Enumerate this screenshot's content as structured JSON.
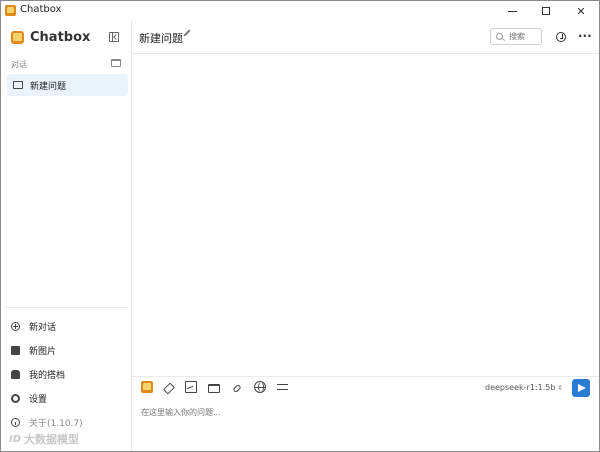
{
  "window": {
    "title": "Chatbox",
    "controls": {
      "minimize": "minimize",
      "maximize": "maximize",
      "close": "✕"
    }
  },
  "sidebar": {
    "brand": "Chatbox",
    "section_label": "对话",
    "conversations": [
      {
        "label": "新建问题",
        "selected": true
      }
    ],
    "menu": [
      {
        "label": "新对话",
        "icon": "plus-circle-icon"
      },
      {
        "label": "新图片",
        "icon": "image-icon"
      },
      {
        "label": "我的搭档",
        "icon": "bot-icon"
      },
      {
        "label": "设置",
        "icon": "gear-icon"
      },
      {
        "label": "关于(1.10.7)",
        "icon": "info-icon"
      }
    ],
    "watermark": {
      "mark": "ID",
      "text": "大数据模型"
    }
  },
  "header": {
    "conversation_title": "新建问题",
    "search_placeholder": "搜索"
  },
  "input": {
    "model": "deepseek-r1:1.5b",
    "placeholder": "在这里输入你的问题..."
  },
  "colors": {
    "accent": "#2b7cd3",
    "selected_bg": "#eaf2fb",
    "brand_orange": "#e08a1e"
  }
}
